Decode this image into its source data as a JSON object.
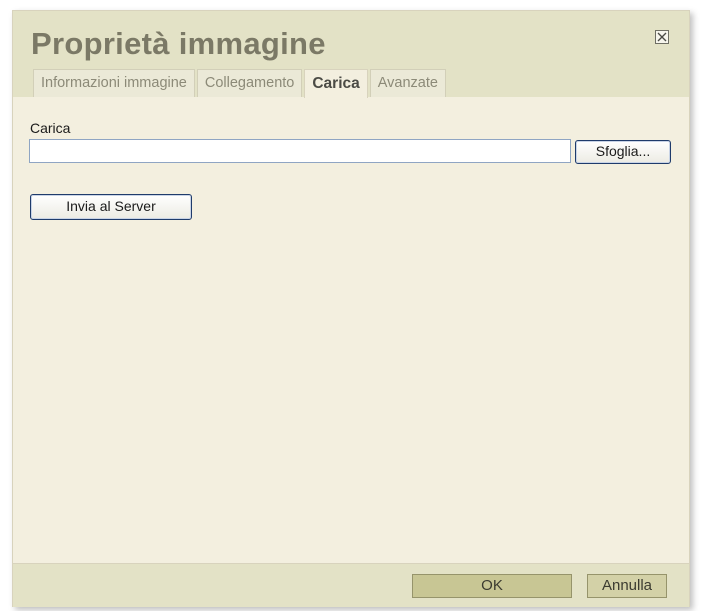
{
  "dialog": {
    "title": "Proprietà immagine",
    "close_icon": "close-icon"
  },
  "tabs": [
    {
      "label": "Informazioni immagine",
      "active": false
    },
    {
      "label": "Collegamento",
      "active": false
    },
    {
      "label": "Carica",
      "active": true
    },
    {
      "label": "Avanzate",
      "active": false
    }
  ],
  "upload": {
    "field_label": "Carica",
    "file_value": "",
    "browse_label": "Sfoglia...",
    "send_label": "Invia al Server"
  },
  "footer": {
    "ok_label": "OK",
    "cancel_label": "Annulla"
  },
  "colors": {
    "dialog_bg": "#f3efdf",
    "header_bg": "#e3e2c6",
    "title_color": "#7b7966",
    "ok_button_bg": "#c8c694"
  }
}
